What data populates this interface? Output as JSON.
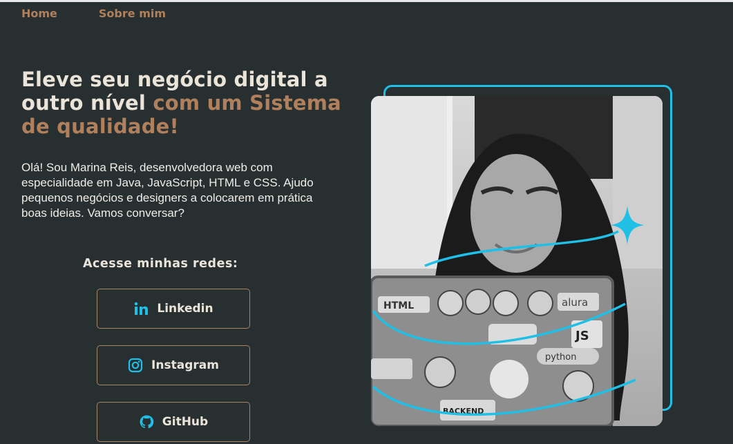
{
  "nav": {
    "items": [
      "Home",
      "Sobre mim"
    ]
  },
  "hero": {
    "title_part1": "Eleve seu negócio digital a outro nível ",
    "title_accent": "com um Sistema de qualidade!",
    "intro": "Olá! Sou Marina Reis, desenvolvedora web com especialidade em Java, JavaScript, HTML e CSS. Ajudo pequenos negócios e designers a colocarem em prática boas ideias. Vamos conversar?"
  },
  "social": {
    "heading": "Acesse minhas redes:",
    "links": [
      {
        "label": "Linkedin",
        "icon": "linkedin-icon"
      },
      {
        "label": "Instagram",
        "icon": "instagram-icon"
      },
      {
        "label": "GitHub",
        "icon": "github-icon"
      }
    ]
  },
  "colors": {
    "background": "#272f31",
    "accent": "#b0805c",
    "highlight": "#1fbfe6",
    "text": "#ebe4d8"
  },
  "photo": {
    "sticker_text": [
      "alura",
      "JS",
      "python",
      "HTML",
      "BACKEND"
    ]
  }
}
